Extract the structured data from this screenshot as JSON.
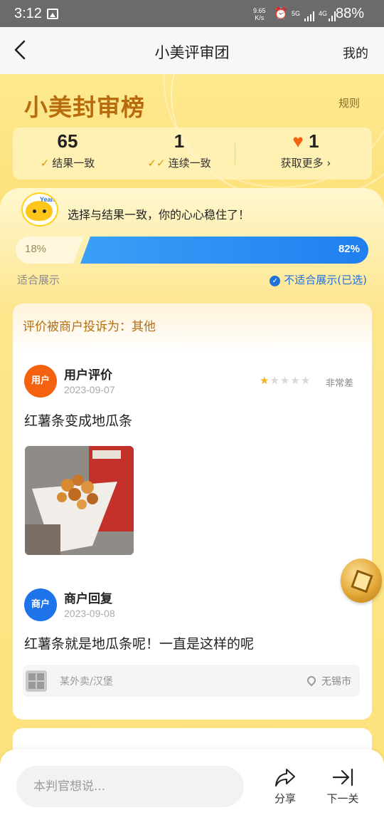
{
  "status_bar": {
    "time": "3:12",
    "net_speed_value": "9.65",
    "net_speed_unit": "K/s",
    "signal_1": "5G",
    "signal_2": "4G",
    "battery": "88%"
  },
  "nav": {
    "title": "小美评审团",
    "right_link": "我的"
  },
  "header": {
    "logo_text": "小美封审榜",
    "rules_link": "规则"
  },
  "stats": [
    {
      "value": "65",
      "label": "结果一致"
    },
    {
      "value": "1",
      "label": "连续一致"
    },
    {
      "value": "1",
      "label": "获取更多 ›"
    }
  ],
  "result": {
    "mascot_text": "Yeah",
    "message": "选择与结果一致，你的心心稳住了！",
    "left_percent": 18,
    "right_percent": 82,
    "left_label": "18%",
    "right_label": "82%",
    "option_left": "适合展示",
    "option_right": "不适合展示(已选)"
  },
  "card": {
    "complaint": "评价被商户投诉为：其他",
    "review": {
      "avatar": "用户",
      "title": "用户评价",
      "date": "2023-09-07",
      "stars": 1,
      "max_stars": 5,
      "rating_text": "非常差",
      "content": "红薯条变成地瓜条"
    },
    "reply": {
      "avatar": "商户",
      "title": "商户回复",
      "date": "2023-09-08",
      "content": "红薯条就是地瓜条呢！一直是这样的呢"
    },
    "shop": {
      "name": "某外卖/汉堡",
      "city": "无锡市"
    }
  },
  "bottom": {
    "comment_placeholder": "本判官想说...",
    "share_label": "分享",
    "next_label": "下一关"
  },
  "colors": {
    "accent_blue": "#1f7ff0",
    "brand_yellow": "#fde27a",
    "user_avatar": "#f5620f",
    "merchant_avatar": "#1e73ea",
    "complaint_text": "#b36f10"
  }
}
